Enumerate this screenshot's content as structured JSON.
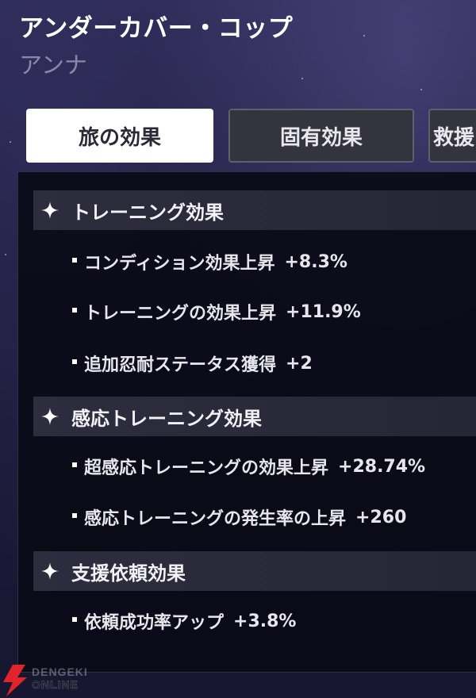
{
  "character": {
    "title": "アンダーカバー・コップ",
    "name": "アンナ"
  },
  "tabs": [
    {
      "label": "旅の効果",
      "active": true
    },
    {
      "label": "固有効果",
      "active": false
    },
    {
      "label": "救援",
      "active": false
    }
  ],
  "sections": [
    {
      "icon": "sparkle-icon",
      "title": "トレーニング効果",
      "items": [
        {
          "label": "コンディション効果上昇",
          "value": "+8.3%"
        },
        {
          "label": "トレーニングの効果上昇",
          "value": "+11.9%"
        },
        {
          "label": "追加忍耐ステータス獲得",
          "value": "+2"
        }
      ]
    },
    {
      "icon": "sparkle-icon",
      "title": "感応トレーニング効果",
      "items": [
        {
          "label": "超感応トレーニングの効果上昇",
          "value": "+28.74%"
        },
        {
          "label": "感応トレーニングの発生率の上昇",
          "value": "+260"
        }
      ]
    },
    {
      "icon": "sparkle-icon",
      "title": "支援依頼効果",
      "items": [
        {
          "label": "依頼成功率アップ",
          "value": "+3.8%"
        }
      ]
    }
  ],
  "watermark": {
    "line1": "DENGEKI",
    "line2": "ONLINE",
    "color": "#e0242c"
  }
}
